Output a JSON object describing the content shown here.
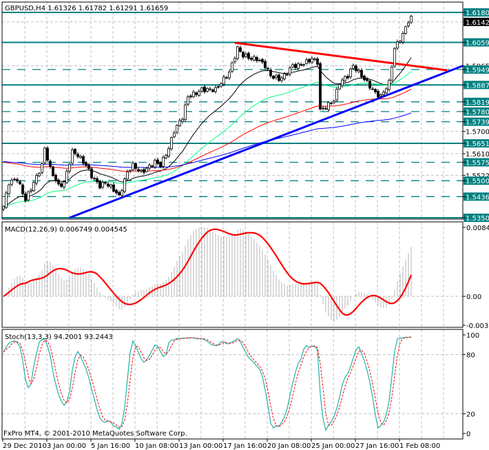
{
  "chart_data": {
    "type": "line",
    "title": "GBPUSD,H4  1.61326 1.61782 1.61291 1.61659",
    "symbol": "GBPUSD,H4",
    "ohlc_readout": "1.61326 1.61782 1.61291 1.61659",
    "copyright": "FxPro MT4, © 2001-2010 MetaQuotes Software Corp.",
    "price_range": [
      1.53509,
      1.61808
    ],
    "price_ticks": [
      "1.61425",
      "1.59650",
      "1.57000",
      "1.56100",
      "1.55225"
    ],
    "current_price": "1.61425",
    "levels_solid": [
      "1.61808",
      "1.60597",
      "1.58876",
      "1.56516",
      "1.53509"
    ],
    "levels_dashed": [
      "1.59499",
      "1.58193",
      "1.57802",
      "1.57390",
      "1.55750",
      "1.55008",
      "1.54363"
    ],
    "x_labels": [
      "29 Dec 2010",
      "3 Jan 00:00",
      "5 Jan 16:00",
      "10 Jan 08:00",
      "13 Jan 00:00",
      "17 Jan 16:00",
      "20 Jan 08:00",
      "25 Jan 00:00",
      "27 Jan 16:00",
      "1 Feb 08:00"
    ],
    "bars_per_label": 16,
    "bar_count": 149,
    "close_path": [
      [
        0,
        1.5396
      ],
      [
        2,
        1.5493
      ],
      [
        5,
        1.5507
      ],
      [
        8,
        1.5423
      ],
      [
        11,
        1.5493
      ],
      [
        14,
        1.5563
      ],
      [
        15,
        1.5632
      ],
      [
        17,
        1.5549
      ],
      [
        20,
        1.5479
      ],
      [
        22,
        1.5493
      ],
      [
        25,
        1.5618
      ],
      [
        27,
        1.5604
      ],
      [
        30,
        1.5563
      ],
      [
        32,
        1.5521
      ],
      [
        35,
        1.5479
      ],
      [
        37,
        1.5493
      ],
      [
        40,
        1.5465
      ],
      [
        42,
        1.5437
      ],
      [
        45,
        1.5535
      ],
      [
        47,
        1.5563
      ],
      [
        50,
        1.5535
      ],
      [
        52,
        1.5549
      ],
      [
        55,
        1.5577
      ],
      [
        57,
        1.5563
      ],
      [
        60,
        1.5632
      ],
      [
        62,
        1.5702
      ],
      [
        65,
        1.5758
      ],
      [
        67,
        1.5841
      ],
      [
        70,
        1.5855
      ],
      [
        72,
        1.5869
      ],
      [
        77,
        1.5869
      ],
      [
        80,
        1.5911
      ],
      [
        82,
        1.5939
      ],
      [
        85,
        1.6036
      ],
      [
        87,
        1.6008
      ],
      [
        90,
        1.5994
      ],
      [
        92,
        1.5994
      ],
      [
        95,
        1.5966
      ],
      [
        97,
        1.5925
      ],
      [
        100,
        1.5911
      ],
      [
        102,
        1.5925
      ],
      [
        105,
        1.5966
      ],
      [
        107,
        1.5966
      ],
      [
        110,
        1.598
      ],
      [
        112,
        1.5994
      ],
      [
        114,
        1.598
      ],
      [
        115,
        1.5785
      ],
      [
        117,
        1.5799
      ],
      [
        120,
        1.5827
      ],
      [
        122,
        1.5897
      ],
      [
        125,
        1.5925
      ],
      [
        127,
        1.5966
      ],
      [
        130,
        1.5925
      ],
      [
        132,
        1.5897
      ],
      [
        135,
        1.5855
      ],
      [
        137,
        1.5841
      ],
      [
        140,
        1.5897
      ],
      [
        141,
        1.5966
      ],
      [
        142,
        1.6036
      ],
      [
        145,
        1.6092
      ],
      [
        146,
        1.612
      ],
      [
        147,
        1.6147
      ],
      [
        148,
        1.6166
      ]
    ],
    "moving_averages": [
      {
        "period": 21,
        "color": "#000000"
      },
      {
        "period": 50,
        "color": "#00ff7f"
      },
      {
        "period": 100,
        "color": "#ff0000"
      },
      {
        "period": 200,
        "color": "#0000ff"
      }
    ],
    "trendlines": [
      {
        "name": "support",
        "color": "#0000ff",
        "from": [
          24,
          1.5351
        ],
        "to": [
          167,
          1.5966
        ]
      },
      {
        "name": "resistance",
        "color": "#ff0000",
        "from": [
          84,
          1.6058
        ],
        "to": [
          161,
          1.5947
        ]
      }
    ],
    "macd": {
      "label": "MACD(12,26,9) 0.006749 0.004545",
      "range": [
        -0.00356,
        0.00847
      ],
      "ticks": [
        "0.00847",
        "0.00",
        "-0.00356"
      ],
      "hist_color": "#c0c0c0",
      "signal_color": "#ff0000"
    },
    "stoch": {
      "label": "Stoch(13,3,3) 94.2001 93.2443",
      "range": [
        0,
        100
      ],
      "ticks": [
        "100",
        "80",
        "20",
        "0"
      ],
      "main_color": "#20b2aa",
      "signal_color": "#ff0000"
    },
    "colors": {
      "level": "#008080",
      "grid": "#c0c0c0"
    }
  }
}
